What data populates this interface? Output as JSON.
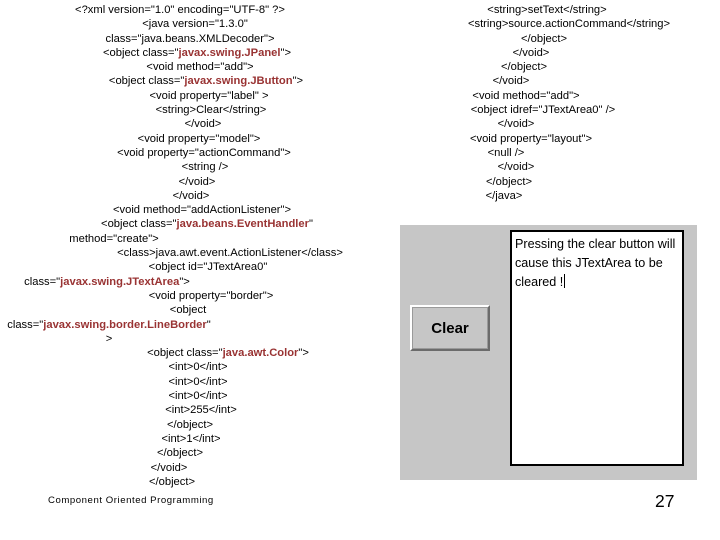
{
  "slide": {
    "footer_title": "Component Oriented Programming",
    "page_number": "27",
    "accent_color": "#993333",
    "panel_color": "#c6c6c6",
    "text_color": "#000000"
  },
  "code_left": [
    {
      "indent": 0,
      "text": "<?xml version=\"1.0\" encoding=\"UTF-8\" ?>"
    },
    {
      "indent": 30,
      "text": "<java version=\"1.3.0\""
    },
    {
      "indent": 20,
      "text": "class=\"java.beans.XMLDecoder\">"
    },
    {
      "indent": 34,
      "text": "<object class=\"",
      "cls": "javax.swing.JPanel",
      "tail": "\">"
    },
    {
      "indent": 40,
      "text": "<void method=\"add\">"
    },
    {
      "indent": 52,
      "text": "<object class=\"",
      "cls": "javax.swing.JButton",
      "tail": "\">"
    },
    {
      "indent": 58,
      "text": "<void property=\"label\" >"
    },
    {
      "indent": 62,
      "text": "<string>Clear</string>"
    },
    {
      "indent": 46,
      "text": "</void>"
    },
    {
      "indent": 38,
      "text": "<void property=\"model\">"
    },
    {
      "indent": 48,
      "text": "<void property=\"actionCommand\">"
    },
    {
      "indent": 50,
      "text": "<string />"
    },
    {
      "indent": 34,
      "text": "</void>"
    },
    {
      "indent": 22,
      "text": "</void>"
    },
    {
      "indent": 44,
      "text": "<void method=\"addActionListener\">"
    },
    {
      "indent": 54,
      "text": "<object class=\"",
      "cls": "java.beans.EventHandler",
      "tail": "\""
    },
    {
      "indent": -132,
      "text": "method=\"create\">"
    },
    {
      "indent": 100,
      "text": "<class>java.awt.event.ActionListener</class>"
    },
    {
      "indent": 56,
      "text": "<object id=\"JTextArea0\""
    },
    {
      "indent": -146,
      "text": "class=\"",
      "cls": "javax.swing.JTextArea",
      "tail": "\">"
    },
    {
      "indent": 62,
      "text": "<void property=\"border\">"
    },
    {
      "indent": 16,
      "text": "<object"
    },
    {
      "indent": -142,
      "text": "class=\"",
      "cls": "javax.swing.border.LineBorder",
      "tail": "\">"
    },
    {
      "indent": 96,
      "text": "<object class=\"",
      "cls": "java.awt.Color",
      "tail": "\">"
    },
    {
      "indent": 36,
      "text": "<int>0</int>"
    },
    {
      "indent": 36,
      "text": "<int>0</int>"
    },
    {
      "indent": 36,
      "text": "<int>0</int>"
    },
    {
      "indent": 42,
      "text": "<int>255</int>"
    },
    {
      "indent": 20,
      "text": "</object>"
    },
    {
      "indent": 22,
      "text": "<int>1</int>"
    },
    {
      "indent": 0,
      "text": "</object>"
    },
    {
      "indent": -22,
      "text": "</void>"
    },
    {
      "indent": -16,
      "text": "</object>"
    }
  ],
  "code_right": [
    {
      "indent": 0,
      "text": "<string>setText</string>"
    },
    {
      "indent": 44,
      "text": "<string>source.actionCommand</string>"
    },
    {
      "indent": -6,
      "text": "</object>"
    },
    {
      "indent": -32,
      "text": "</void>"
    },
    {
      "indent": -46,
      "text": "</object>"
    },
    {
      "indent": -72,
      "text": "</void>"
    },
    {
      "indent": -42,
      "text": "<void method=\"add\">"
    },
    {
      "indent": -8,
      "text": "<object idref=\"JTextArea0\" />"
    },
    {
      "indent": -62,
      "text": "</void>"
    },
    {
      "indent": -32,
      "text": "<void property=\"layout\">"
    },
    {
      "indent": -82,
      "text": "<null />"
    },
    {
      "indent": -62,
      "text": "</void>"
    },
    {
      "indent": -76,
      "text": "</object>"
    },
    {
      "indent": -86,
      "text": "</java>"
    }
  ],
  "swing_demo": {
    "clear_button_label": "Clear",
    "textarea_value": "Pressing the clear button will cause this JTextArea to be cleared !",
    "textarea_has_caret": true
  }
}
